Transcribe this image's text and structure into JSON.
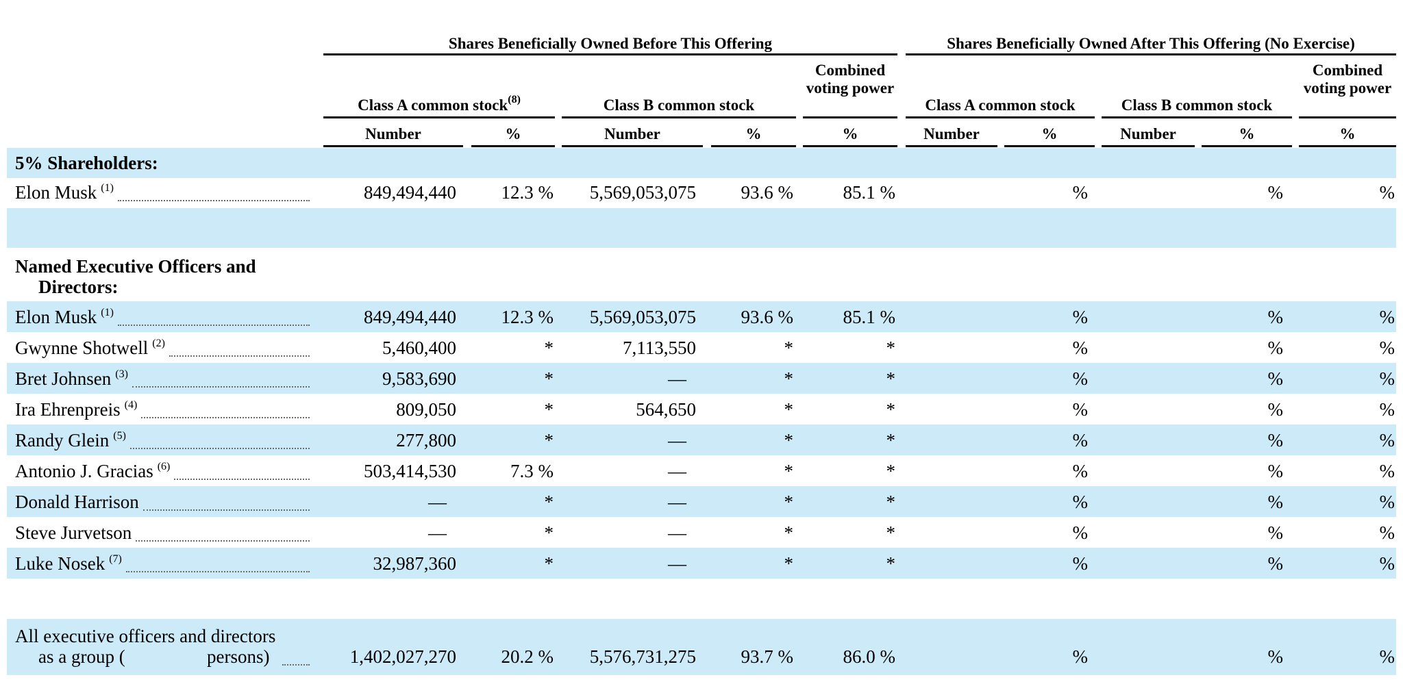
{
  "header": {
    "group_before": "Shares Beneficially Owned Before This Offering",
    "group_after": "Shares Beneficially Owned After This Offering (No Exercise)",
    "class_a": "Class A common stock",
    "class_a_note": "(8)",
    "class_b": "Class B common stock",
    "combined": "Combined voting power",
    "number": "Number",
    "pct": "%"
  },
  "sections": {
    "five_pct": "5% Shareholders:",
    "officers_line1": "Named Executive Officers and",
    "officers_line2": "Directors:"
  },
  "rows": [
    {
      "name": "Elon Musk",
      "note": "(1)",
      "a_num": "849,494,440",
      "a_pct": "12.3 %",
      "b_num": "5,569,053,075",
      "b_pct": "93.6 %",
      "vote": "85.1 %",
      "after_a_pct": "%",
      "after_b_pct": "%",
      "after_vote": "%"
    },
    {
      "name": "Elon Musk",
      "note": "(1)",
      "a_num": "849,494,440",
      "a_pct": "12.3 %",
      "b_num": "5,569,053,075",
      "b_pct": "93.6 %",
      "vote": "85.1 %",
      "after_a_pct": "%",
      "after_b_pct": "%",
      "after_vote": "%"
    },
    {
      "name": "Gwynne Shotwell",
      "note": "(2)",
      "a_num": "5,460,400",
      "a_pct": "*",
      "b_num": "7,113,550",
      "b_pct": "*",
      "vote": "*",
      "after_a_pct": "%",
      "after_b_pct": "%",
      "after_vote": "%"
    },
    {
      "name": "Bret Johnsen",
      "note": "(3)",
      "a_num": "9,583,690",
      "a_pct": "*",
      "b_num": "—",
      "b_pct": "*",
      "vote": "*",
      "after_a_pct": "%",
      "after_b_pct": "%",
      "after_vote": "%"
    },
    {
      "name": "Ira Ehrenpreis",
      "note": "(4)",
      "a_num": "809,050",
      "a_pct": "*",
      "b_num": "564,650",
      "b_pct": "*",
      "vote": "*",
      "after_a_pct": "%",
      "after_b_pct": "%",
      "after_vote": "%"
    },
    {
      "name": "Randy Glein",
      "note": "(5)",
      "a_num": "277,800",
      "a_pct": "*",
      "b_num": "—",
      "b_pct": "*",
      "vote": "*",
      "after_a_pct": "%",
      "after_b_pct": "%",
      "after_vote": "%"
    },
    {
      "name": "Antonio J. Gracias",
      "note": "(6)",
      "a_num": "503,414,530",
      "a_pct": "7.3 %",
      "b_num": "—",
      "b_pct": "*",
      "vote": "*",
      "after_a_pct": "%",
      "after_b_pct": "%",
      "after_vote": "%"
    },
    {
      "name": "Donald Harrison",
      "note": "",
      "a_num": "—",
      "a_pct": "*",
      "b_num": "—",
      "b_pct": "*",
      "vote": "*",
      "after_a_pct": "%",
      "after_b_pct": "%",
      "after_vote": "%"
    },
    {
      "name": "Steve Jurvetson",
      "note": "",
      "a_num": "—",
      "a_pct": "*",
      "b_num": "—",
      "b_pct": "*",
      "vote": "*",
      "after_a_pct": "%",
      "after_b_pct": "%",
      "after_vote": "%"
    },
    {
      "name": "Luke Nosek",
      "note": "(7)",
      "a_num": "32,987,360",
      "a_pct": "*",
      "b_num": "—",
      "b_pct": "*",
      "vote": "*",
      "after_a_pct": "%",
      "after_b_pct": "%",
      "after_vote": "%"
    }
  ],
  "group_row": {
    "line1": "All executive officers and directors",
    "line2_a": "as a group (",
    "line2_b": "persons)",
    "a_num": "1,402,027,270",
    "a_pct": "20.2 %",
    "b_num": "5,576,731,275",
    "b_pct": "93.7 %",
    "vote": "86.0 %",
    "after_a_pct": "%",
    "after_b_pct": "%",
    "after_vote": "%"
  },
  "colors": {
    "band": "#cdeaf9",
    "rule": "#000000",
    "leader": "#6a6a6a"
  }
}
